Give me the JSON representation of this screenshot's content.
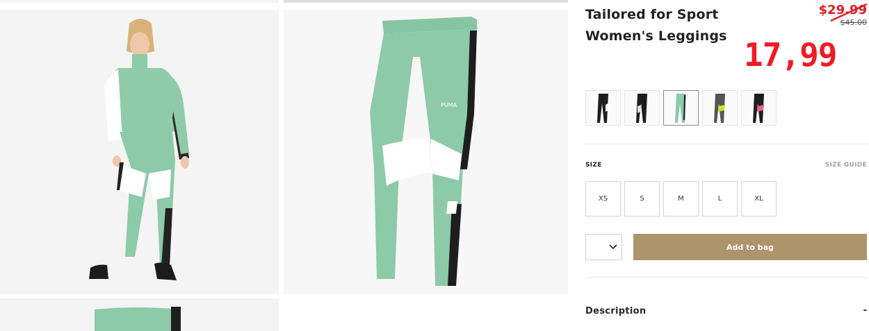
{
  "product": {
    "title_line1": "Tailored for Sport",
    "title_line2": "Women's Leggings",
    "price_old": "$29.99",
    "price_msrp": "$45.00",
    "price_new": "17,99"
  },
  "colors": {
    "accent_price": "#ee1c25",
    "add_to_bag_bg": "#ad946b",
    "leggings_mint": "#8dcaa8"
  },
  "swatches": [
    {
      "name": "black-white",
      "selected": false
    },
    {
      "name": "black-beige",
      "selected": false
    },
    {
      "name": "mint-green",
      "selected": true
    },
    {
      "name": "grey-lime",
      "selected": false
    },
    {
      "name": "black-pink",
      "selected": false
    }
  ],
  "size_section": {
    "label": "SIZE",
    "guide": "SIZE GUIDE",
    "options": [
      "XS",
      "S",
      "M",
      "L",
      "XL"
    ]
  },
  "actions": {
    "quantity_icon": "chevron-down-icon",
    "add_to_bag": "Add to bag"
  },
  "description": {
    "label": "Description",
    "toggle": "-"
  }
}
